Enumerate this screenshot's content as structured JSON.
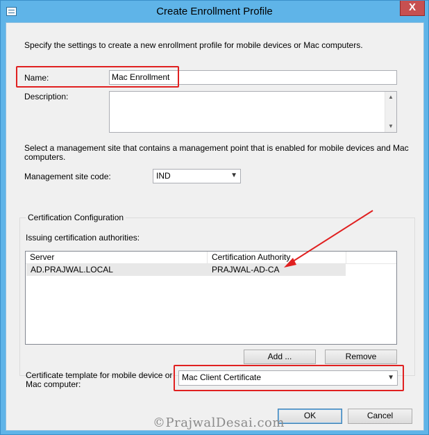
{
  "window": {
    "title": "Create Enrollment Profile",
    "close_glyph": "X",
    "app_icon": "dialog-form-icon"
  },
  "form": {
    "intro": "Specify the settings to create a new enrollment profile for mobile devices or Mac computers.",
    "name_label": "Name:",
    "name_value": "Mac Enrollment",
    "description_label": "Description:",
    "description_value": "",
    "mgmt_text_line1": "Select a management site that contains a management point that is enabled for mobile devices and Mac",
    "mgmt_text_line2": "computers.",
    "site_code_label": "Management site code:",
    "site_code_value": "IND"
  },
  "cert": {
    "group_label": "Certification Configuration",
    "issuing_label": "Issuing certification authorities:",
    "columns": [
      "Server",
      "Certification Authority"
    ],
    "rows": [
      {
        "server": "AD.PRAJWAL.LOCAL",
        "authority": "PRAJWAL-AD-CA"
      }
    ],
    "add_label": "Add ...",
    "remove_label": "Remove",
    "template_label_line1": "Certificate template for mobile device or",
    "template_label_line2": "Mac computer:",
    "template_value": "Mac Client Certificate"
  },
  "footer": {
    "ok_label": "OK",
    "cancel_label": "Cancel"
  },
  "watermark": "©PrajwalDesai.com",
  "colors": {
    "highlight": "#e02020",
    "titlebar": "#5fb4e8",
    "close": "#c75050"
  }
}
